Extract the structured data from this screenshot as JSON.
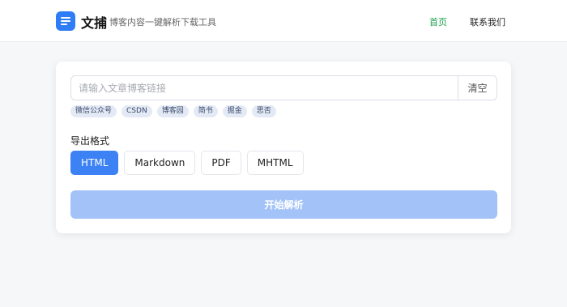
{
  "header": {
    "brand": "文捕",
    "tagline": "博客内容一键解析下载工具",
    "nav": {
      "home": "首页",
      "contact": "联系我们"
    }
  },
  "search": {
    "placeholder": "请输入文章博客链接",
    "value": "",
    "clear_label": "清空"
  },
  "platforms": [
    "微信公众号",
    "CSDN",
    "博客园",
    "简书",
    "掘金",
    "思否"
  ],
  "export": {
    "label": "导出格式",
    "formats": [
      "HTML",
      "Markdown",
      "PDF",
      "MHTML"
    ],
    "selected": "HTML"
  },
  "start_label": "开始解析",
  "colors": {
    "accent": "#3d82f4",
    "nav_active": "#1aa34a",
    "start_disabled": "#a3c3f8"
  }
}
